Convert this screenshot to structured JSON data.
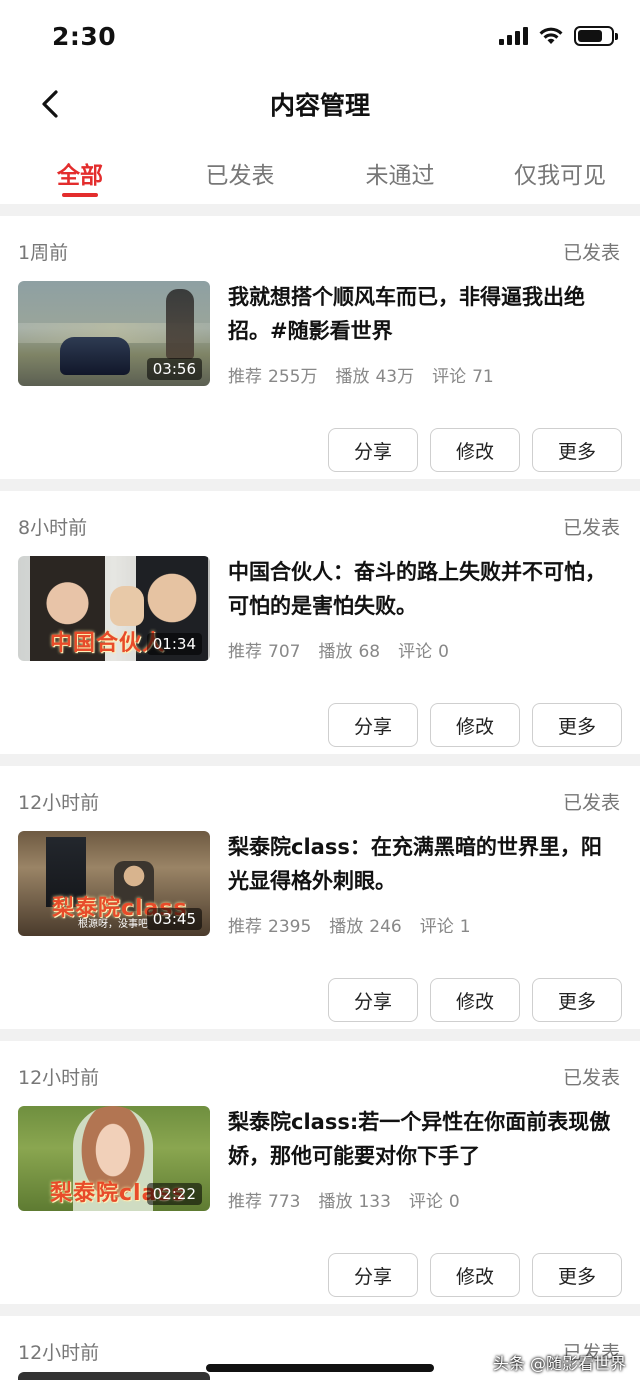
{
  "status_bar": {
    "time": "2:30",
    "battery_level": 0.75
  },
  "nav": {
    "title": "内容管理",
    "back_icon": "chevron-left-icon"
  },
  "tabs": [
    {
      "label": "全部",
      "active": true
    },
    {
      "label": "已发表",
      "active": false
    },
    {
      "label": "未通过",
      "active": false
    },
    {
      "label": "仅我可见",
      "active": false
    }
  ],
  "accent_color": "#e32d2d",
  "items": [
    {
      "time": "1周前",
      "status": "已发表",
      "title": "我就想搭个顺风车而已，非得逼我出绝招。#随影看世界",
      "duration": "03:56",
      "thumb_caption": "",
      "stats": {
        "rec_label": "推荐",
        "rec": "255万",
        "play_label": "播放",
        "play": "43万",
        "comment_label": "评论",
        "comment": "71"
      },
      "actions": {
        "share": "分享",
        "edit": "修改",
        "more": "更多"
      }
    },
    {
      "time": "8小时前",
      "status": "已发表",
      "title": "中国合伙人：奋斗的路上失败并不可怕，可怕的是害怕失败。",
      "duration": "01:34",
      "thumb_caption": "中国合伙人",
      "stats": {
        "rec_label": "推荐",
        "rec": "707",
        "play_label": "播放",
        "play": "68",
        "comment_label": "评论",
        "comment": "0"
      },
      "actions": {
        "share": "分享",
        "edit": "修改",
        "more": "更多"
      }
    },
    {
      "time": "12小时前",
      "status": "已发表",
      "title": "梨泰院class：在充满黑暗的世界里，阳光显得格外刺眼。",
      "duration": "03:45",
      "thumb_caption": "梨泰院class",
      "thumb_subtitle": "根源呀，没事吧",
      "stats": {
        "rec_label": "推荐",
        "rec": "2395",
        "play_label": "播放",
        "play": "246",
        "comment_label": "评论",
        "comment": "1"
      },
      "actions": {
        "share": "分享",
        "edit": "修改",
        "more": "更多"
      }
    },
    {
      "time": "12小时前",
      "status": "已发表",
      "title": "梨泰院class:若一个异性在你面前表现傲娇，那他可能要对你下手了",
      "duration": "02:22",
      "thumb_caption": "梨泰院class",
      "stats": {
        "rec_label": "推荐",
        "rec": "773",
        "play_label": "播放",
        "play": "133",
        "comment_label": "评论",
        "comment": "0"
      },
      "actions": {
        "share": "分享",
        "edit": "修改",
        "more": "更多"
      }
    },
    {
      "time": "12小时前",
      "status": "已发表"
    }
  ],
  "watermark": "头条 @随影看世界"
}
